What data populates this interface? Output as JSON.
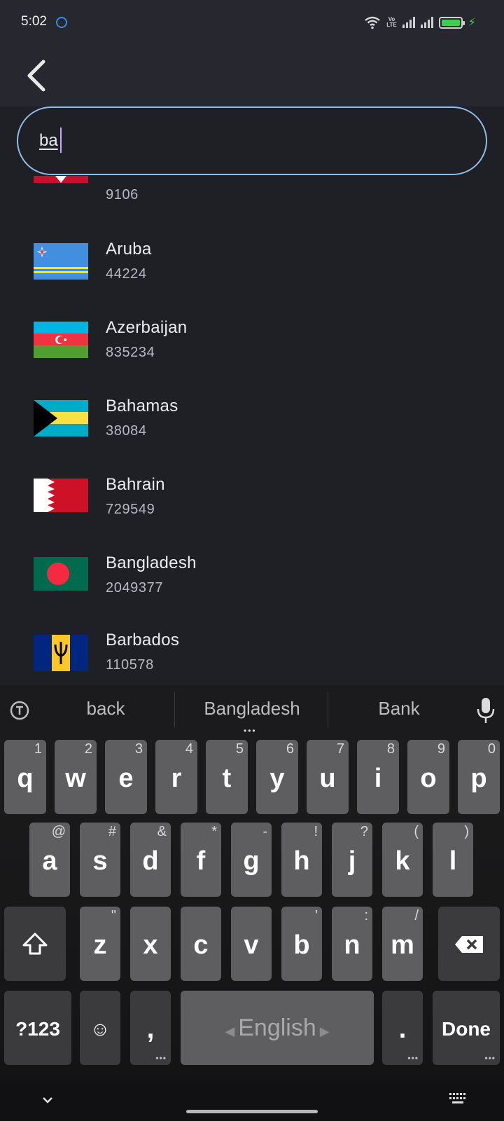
{
  "status": {
    "time": "5:02",
    "network": "LTE",
    "volte": "Vo\nLTE"
  },
  "search": {
    "value": "ba"
  },
  "countries": [
    {
      "name": "",
      "count": "9106",
      "flag": "partial-red-flag"
    },
    {
      "name": "Aruba",
      "count": "44224",
      "flag": "aruba-flag"
    },
    {
      "name": "Azerbaijan",
      "count": "835234",
      "flag": "azerbaijan-flag"
    },
    {
      "name": "Bahamas",
      "count": "38084",
      "flag": "bahamas-flag"
    },
    {
      "name": "Bahrain",
      "count": "729549",
      "flag": "bahrain-flag"
    },
    {
      "name": "Bangladesh",
      "count": "2049377",
      "flag": "bangladesh-flag"
    },
    {
      "name": "Barbados",
      "count": "110578",
      "flag": "barbados-flag"
    }
  ],
  "keyboard": {
    "suggestions": [
      "back",
      "Bangladesh",
      "Bank"
    ],
    "row1": [
      {
        "k": "q",
        "h": "1"
      },
      {
        "k": "w",
        "h": "2"
      },
      {
        "k": "e",
        "h": "3"
      },
      {
        "k": "r",
        "h": "4"
      },
      {
        "k": "t",
        "h": "5"
      },
      {
        "k": "y",
        "h": "6"
      },
      {
        "k": "u",
        "h": "7"
      },
      {
        "k": "i",
        "h": "8"
      },
      {
        "k": "o",
        "h": "9"
      },
      {
        "k": "p",
        "h": "0"
      }
    ],
    "row2": [
      {
        "k": "a",
        "h": "@"
      },
      {
        "k": "s",
        "h": "#"
      },
      {
        "k": "d",
        "h": "&"
      },
      {
        "k": "f",
        "h": "*"
      },
      {
        "k": "g",
        "h": "-"
      },
      {
        "k": "h",
        "h": "!"
      },
      {
        "k": "j",
        "h": "?"
      },
      {
        "k": "k",
        "h": "("
      },
      {
        "k": "l",
        "h": ")"
      }
    ],
    "row3": [
      {
        "k": "z",
        "h": "\""
      },
      {
        "k": "x",
        "h": ""
      },
      {
        "k": "c",
        "h": ""
      },
      {
        "k": "v",
        "h": ""
      },
      {
        "k": "b",
        "h": "'"
      },
      {
        "k": "n",
        "h": ":"
      },
      {
        "k": "m",
        "h": "/"
      }
    ],
    "symbols_label": "?123",
    "emoji_label": "☺",
    "comma_label": ",",
    "space_label": "English",
    "period_label": ".",
    "done_label": "Done"
  }
}
